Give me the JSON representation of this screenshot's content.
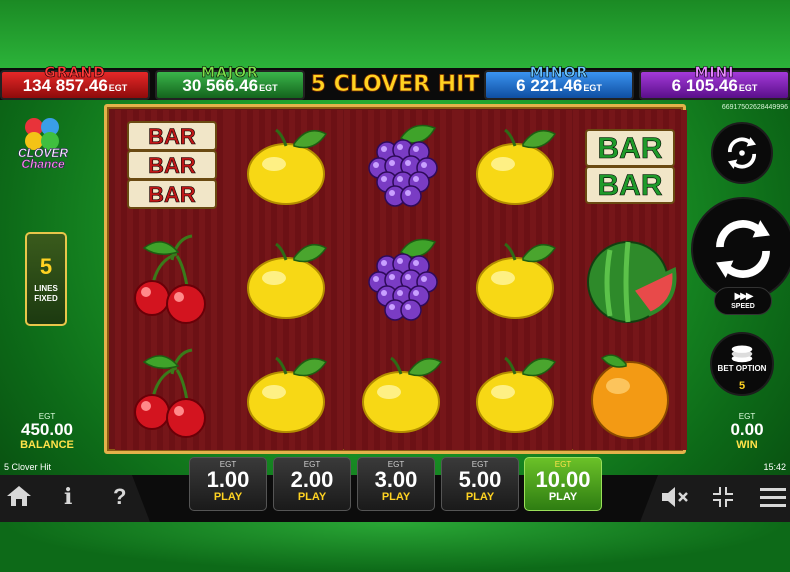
{
  "game": {
    "title": "5 CLOVER HIT",
    "footer_name": "5 Clover Hit",
    "clock": "15:42",
    "session_id": "66917502628449996"
  },
  "jackpots": [
    {
      "name": "GRAND",
      "value": "134 857.46",
      "currency": "EGT"
    },
    {
      "name": "MAJOR",
      "value": "30 566.46",
      "currency": "EGT"
    },
    {
      "name": "MINOR",
      "value": "6 221.46",
      "currency": "EGT"
    },
    {
      "name": "MINI",
      "value": "6 105.46",
      "currency": "EGT"
    }
  ],
  "clover_chance": {
    "line1": "CLOVER",
    "line2": "Chance"
  },
  "lines": {
    "count": "5",
    "label": "LINES FIXED"
  },
  "balance": {
    "currency": "EGT",
    "value": "450.00",
    "label": "BALANCE"
  },
  "win": {
    "currency": "EGT",
    "value": "0.00",
    "label": "WIN"
  },
  "speed": {
    "label": "SPEED"
  },
  "bet_option": {
    "label": "BET OPTION",
    "value": "5"
  },
  "reels": [
    [
      "bar-triple",
      "cherry",
      "cherry"
    ],
    [
      "lemon",
      "lemon",
      "lemon"
    ],
    [
      "grape",
      "grape",
      "lemon"
    ],
    [
      "lemon",
      "lemon",
      "lemon"
    ],
    [
      "bar-double",
      "watermelon",
      "orange"
    ]
  ],
  "bar_text": "BAR",
  "bets": [
    {
      "currency": "EGT",
      "amount": "1.00",
      "label": "PLAY",
      "active": false
    },
    {
      "currency": "EGT",
      "amount": "2.00",
      "label": "PLAY",
      "active": false
    },
    {
      "currency": "EGT",
      "amount": "3.00",
      "label": "PLAY",
      "active": false
    },
    {
      "currency": "EGT",
      "amount": "5.00",
      "label": "PLAY",
      "active": false
    },
    {
      "currency": "EGT",
      "amount": "10.00",
      "label": "PLAY",
      "active": true
    }
  ],
  "nav": {
    "info": "i",
    "help": "?"
  },
  "colors": {
    "accent": "#ffd322",
    "reel_bg": "#6a1216",
    "frame": "#e3b24a"
  }
}
